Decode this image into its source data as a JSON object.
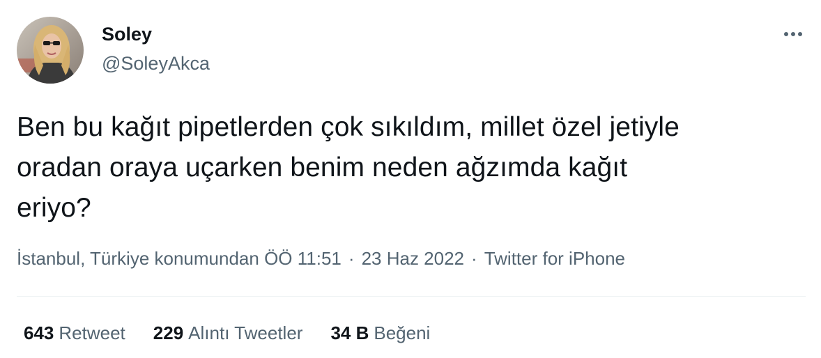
{
  "author": {
    "display_name": "Soley",
    "handle": "@SoleyAkca"
  },
  "tweet": {
    "text": "Ben bu kağıt pipetlerden çok sıkıldım, millet özel jetiyle\noradan oraya uçarken benim neden ağzımda kağıt\neriyo?",
    "location": "İstanbul, Türkiye konumundan",
    "time": "ÖÖ 11:51",
    "date": "23 Haz 2022",
    "source": "Twitter for iPhone",
    "separator": "·"
  },
  "stats": {
    "retweets": {
      "count": "643",
      "label": "Retweet"
    },
    "quotes": {
      "count": "229",
      "label": "Alıntı Tweetler"
    },
    "likes": {
      "count": "34 B",
      "label": "Beğeni"
    }
  },
  "icons": {
    "more": "more-horizontal-icon"
  },
  "colors": {
    "primary_text": "#0f1419",
    "secondary_text": "#536471",
    "divider": "#eff3f4",
    "background": "#ffffff"
  }
}
